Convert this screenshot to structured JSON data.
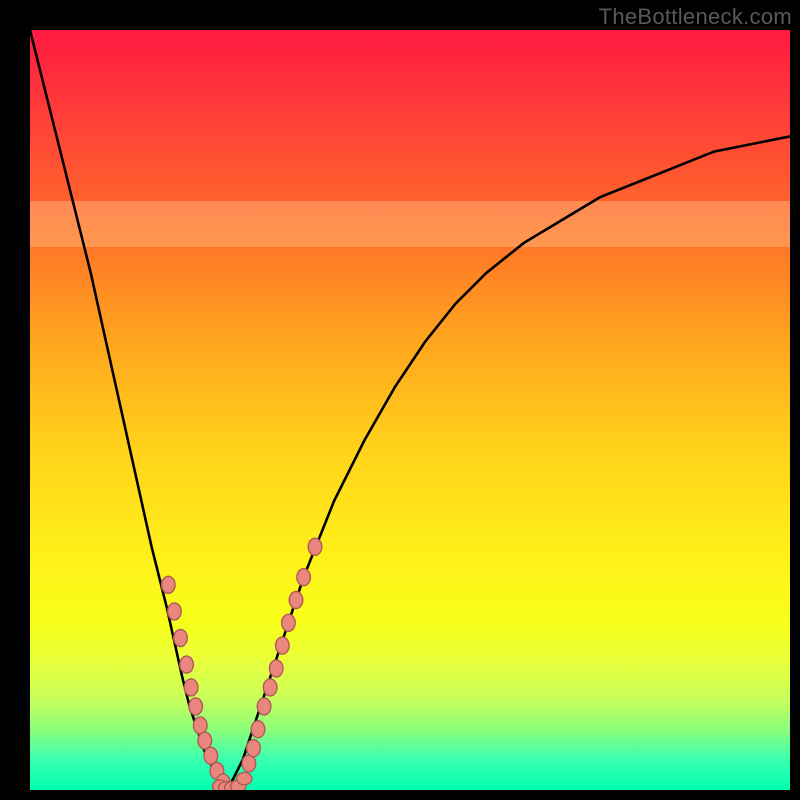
{
  "watermark": "TheBottleneck.com",
  "colors": {
    "page_bg": "#000000",
    "gradient_top": "#ff1a40",
    "gradient_bottom": "#00ffb2",
    "curve": "#000000",
    "bead_fill": "#e9877e",
    "bead_stroke": "#b05a55",
    "watermark": "#595959"
  },
  "chart_data": {
    "type": "line",
    "title": "",
    "xlabel": "",
    "ylabel": "",
    "xlim": [
      0,
      100
    ],
    "ylim": [
      0,
      100
    ],
    "grid": false,
    "legend": false,
    "background": "vertical gradient red→yellow→green with black border",
    "highlight_band_y": [
      71.5,
      77.5
    ],
    "series": [
      {
        "name": "left-branch",
        "x": [
          0,
          2,
          4,
          6,
          8,
          10,
          12,
          14,
          16,
          18,
          20,
          21,
          22,
          23,
          24,
          25,
          26
        ],
        "y": [
          100,
          92,
          84,
          76,
          68,
          59,
          50,
          41,
          32,
          24,
          15,
          11,
          8,
          5,
          3,
          1,
          0
        ]
      },
      {
        "name": "right-branch",
        "x": [
          26,
          28,
          30,
          32,
          34,
          36,
          38,
          40,
          44,
          48,
          52,
          56,
          60,
          65,
          70,
          75,
          80,
          85,
          90,
          95,
          100
        ],
        "y": [
          0,
          4,
          10,
          16,
          22,
          28,
          33,
          38,
          46,
          53,
          59,
          64,
          68,
          72,
          75,
          78,
          80,
          82,
          84,
          85,
          86
        ]
      },
      {
        "name": "beads-left",
        "x": [
          18.2,
          19.0,
          19.8,
          20.6,
          21.2,
          21.8,
          22.4,
          23.0,
          23.8,
          24.6,
          25.4
        ],
        "y": [
          27.0,
          23.5,
          20.0,
          16.5,
          13.5,
          11.0,
          8.5,
          6.5,
          4.5,
          2.5,
          1.0
        ]
      },
      {
        "name": "beads-bottom",
        "x": [
          25.0,
          25.8,
          26.6,
          27.4,
          28.2
        ],
        "y": [
          0.5,
          0.3,
          0.3,
          0.5,
          1.5
        ]
      },
      {
        "name": "beads-right",
        "x": [
          28.8,
          29.4,
          30.0,
          30.8,
          31.6,
          32.4,
          33.2,
          34.0,
          35.0,
          36.0,
          37.5
        ],
        "y": [
          3.5,
          5.5,
          8.0,
          11.0,
          13.5,
          16.0,
          19.0,
          22.0,
          25.0,
          28.0,
          32.0
        ]
      }
    ]
  }
}
